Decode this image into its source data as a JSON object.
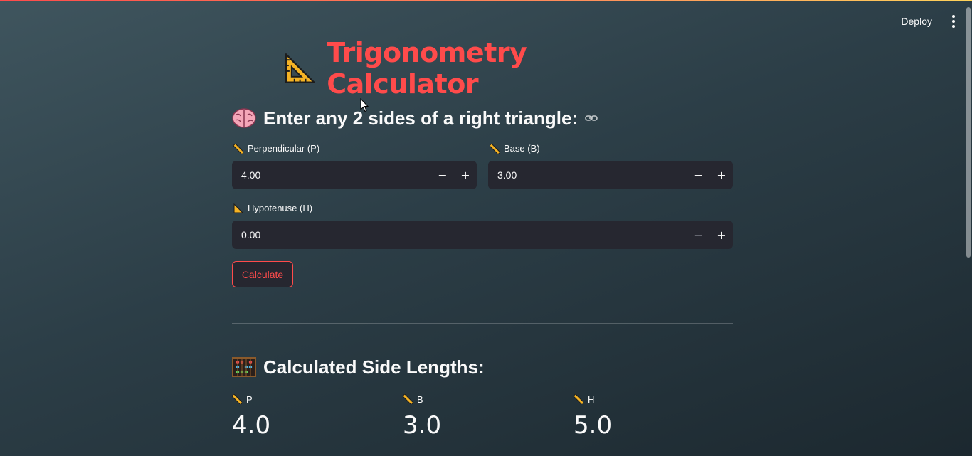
{
  "header": {
    "deploy_label": "Deploy",
    "menu_icon": "more-vertical-icon"
  },
  "title": {
    "icon": "triangular-ruler-icon",
    "text": "Trigonometry Calculator",
    "color": "#ff4b4b"
  },
  "input_section": {
    "icon": "brain-icon",
    "heading": "Enter any 2 sides of a right triangle:",
    "fields": [
      {
        "icon": "straight-ruler-icon",
        "label": "Perpendicular (P)",
        "value": "4.00"
      },
      {
        "icon": "straight-ruler-icon",
        "label": "Base (B)",
        "value": "3.00"
      },
      {
        "icon": "triangular-ruler-icon",
        "label": "Hypotenuse (H)",
        "value": "0.00"
      }
    ],
    "step_minus": "−",
    "step_plus": "+",
    "calculate_label": "Calculate"
  },
  "results": {
    "icon": "abacus-icon",
    "heading": "Calculated Side Lengths:",
    "metrics": [
      {
        "icon": "straight-ruler-icon",
        "label": "P",
        "value": "4.0"
      },
      {
        "icon": "straight-ruler-icon",
        "label": "B",
        "value": "3.0"
      },
      {
        "icon": "straight-ruler-icon",
        "label": "H",
        "value": "5.0"
      }
    ]
  },
  "colors": {
    "accent": "#ff4b4b",
    "input_bg": "#262730",
    "text": "#fafafa"
  }
}
